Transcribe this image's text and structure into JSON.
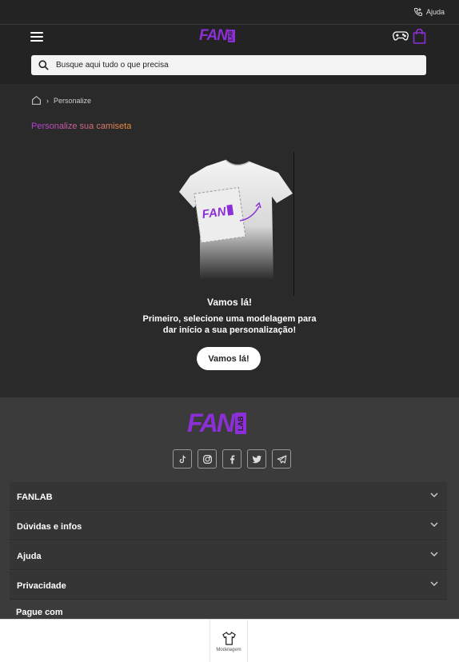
{
  "topbar": {
    "help_label": "Ajuda"
  },
  "header": {
    "logo": "FAN",
    "logo_suffix": "LAB",
    "search_placeholder": "Busque aqui tudo o que precisa"
  },
  "breadcrumb": {
    "current": "Personalize"
  },
  "page": {
    "title": "Personalize sua camiseta",
    "step_title": "Vamos lá!",
    "step_desc": "Primeiro, selecione uma modelagem para dar início a sua personalização!",
    "start_button": "Vamos lá!"
  },
  "footer": {
    "logo": "FAN",
    "logo_suffix": "LAB",
    "socials": [
      "tiktok-icon",
      "instagram-icon",
      "facebook-icon",
      "twitter-icon",
      "telegram-icon"
    ],
    "sections": [
      {
        "label": "FANLAB"
      },
      {
        "label": "Dúvidas e infos"
      },
      {
        "label": "Ajuda"
      },
      {
        "label": "Privacidade"
      }
    ],
    "pay_label": "Pague com"
  },
  "bottom_bar": {
    "model_tab": "Modelagem"
  },
  "colors": {
    "brand": "#8d2fd6",
    "gradient_start": "#b43be0",
    "gradient_end": "#f0923a"
  }
}
